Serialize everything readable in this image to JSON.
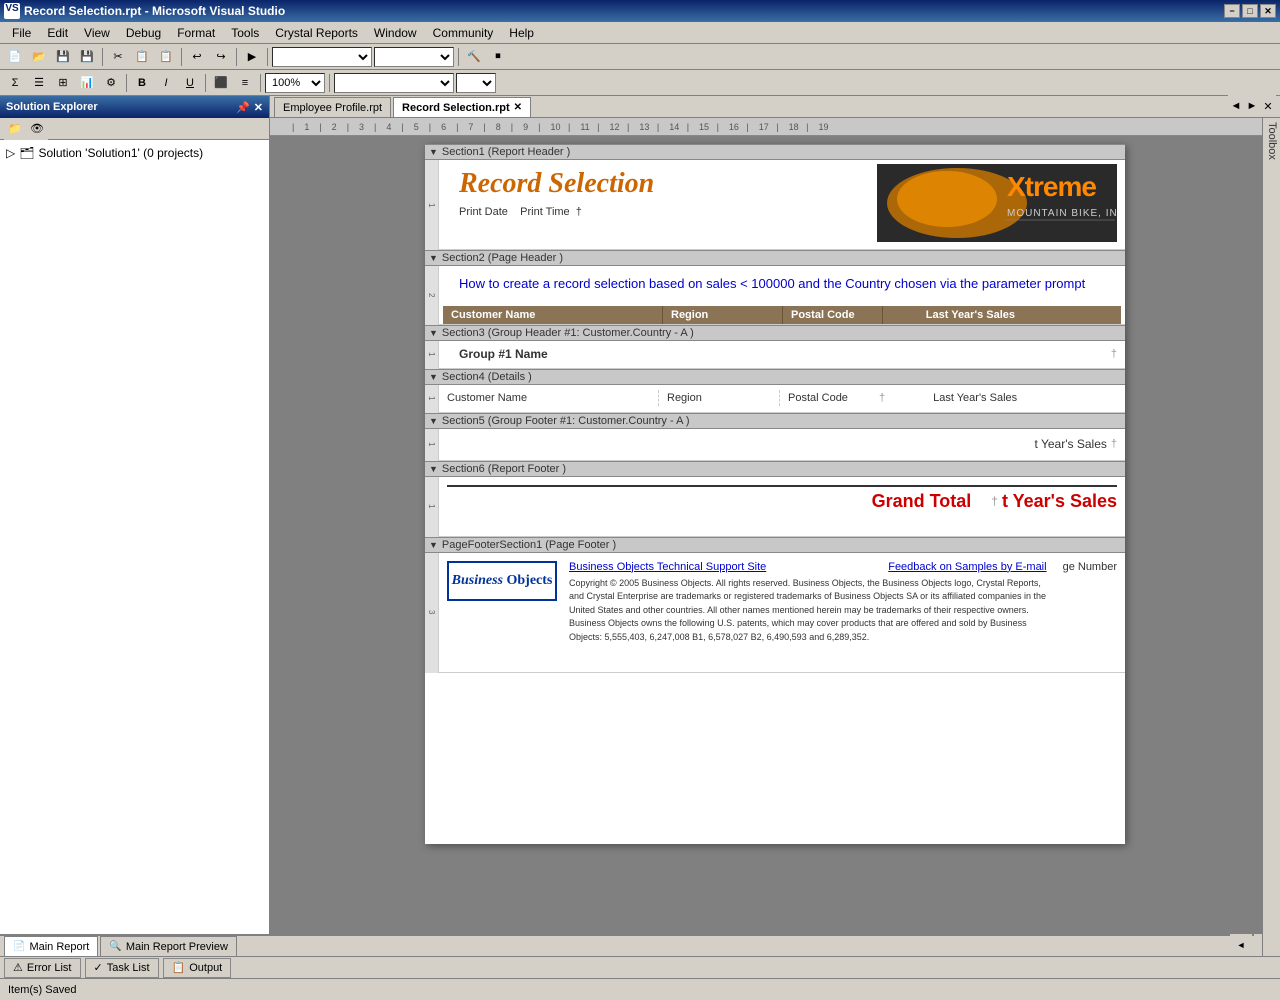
{
  "titlebar": {
    "title": "Record Selection.rpt - Microsoft Visual Studio",
    "icon": "VS",
    "min_label": "−",
    "max_label": "□",
    "close_label": "✕"
  },
  "menubar": {
    "items": [
      "File",
      "Edit",
      "View",
      "Debug",
      "Format",
      "Tools",
      "Crystal Reports",
      "Window",
      "Community",
      "Help"
    ]
  },
  "toolbar1": {
    "zoom": "100%"
  },
  "solution_explorer": {
    "title": "Solution Explorer",
    "solution_label": "Solution 'Solution1' (0 projects)"
  },
  "tabs": {
    "employee_tab": "Employee Profile.rpt",
    "active_tab": "Record Selection.rpt"
  },
  "report": {
    "section1_label": "Section1 (Report Header )",
    "section2_label": "Section2 (Page Header )",
    "section3_label": "Section3 (Group Header #1: Customer.Country - A )",
    "section4_label": "Section4 (Details )",
    "section5_label": "Section5 (Group Footer #1: Customer.Country - A )",
    "section6_label": "Section6 (Report Footer )",
    "section7_label": "PageFooterSection1 (Page Footer )",
    "report_title": "Record Selection",
    "print_date": "Print Date",
    "print_time": "Print Time",
    "page_header_text": "How to create a record selection based on sales < 100000 and the Country chosen via the parameter prompt",
    "col_headers": [
      "Customer Name",
      "Region",
      "Postal Code",
      "Last Year's Sales"
    ],
    "group1_name": "Group #1 Name",
    "detail_customer": "Customer Name",
    "detail_region": "Region",
    "detail_postal": "Postal Code",
    "detail_sales": "Last Year's Sales",
    "yr_sales_footer": "t Year's Sales",
    "grand_total": "Grand Total",
    "grand_total_sales": "t Year's Sales",
    "footer_link1": "Business Objects Technical Support Site",
    "footer_link2": "Feedback on Samples by E-mail",
    "footer_copyright": "Copyright © 2005 Business Objects. All rights reserved. Business Objects, the Business Objects logo, Crystal Reports, and Crystal Enterprise are trademarks or registered trademarks of Business Objects SA or its affiliated companies in the United States and other countries. All other names mentioned herein may be trademarks of their respective owners. Business Objects owns the following U.S. patents, which may cover products that are offered and sold by Business Objects: 5,555,403, 6,247,008 B1, 6,578,027 B2, 6,490,593 and 6,289,352.",
    "page_number": "ge Number",
    "bo_logo": "Business Objects"
  },
  "bottom_tabs": {
    "tab1": "Main Report",
    "tab2": "Main Report Preview"
  },
  "status_bar": {
    "message": "Item(s) Saved"
  },
  "error_list": "Error List",
  "task_list": "Task List",
  "output": "Output",
  "toolbox": "Toolbox",
  "nav_arrows": [
    "◄",
    "►"
  ],
  "close_x": "✕",
  "last_years_sales": "Last Year's Sales"
}
